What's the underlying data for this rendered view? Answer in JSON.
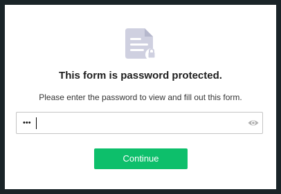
{
  "dialog": {
    "title": "This form is password protected.",
    "subtitle": "Please enter the password to view and fill out this form.",
    "icon": "document-lock-icon",
    "password": {
      "value_masked": "•••",
      "reveal_icon": "eye-icon"
    },
    "continue_label": "Continue"
  },
  "colors": {
    "background": "#1a2428",
    "dialog_bg": "#ffffff",
    "icon": "#cfd0e0",
    "button": "#0dbf6b"
  }
}
